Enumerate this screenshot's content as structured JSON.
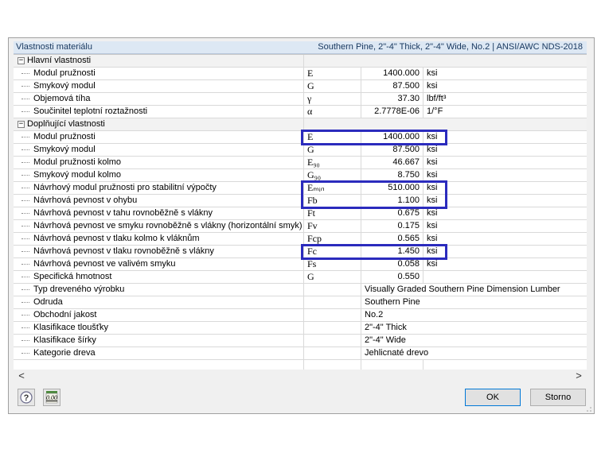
{
  "header": {
    "title": "Vlastnosti materiálu",
    "material": "Southern Pine, 2\"-4\" Thick, 2\"-4\" Wide, No.2  |  ANSI/AWC NDS-2018"
  },
  "sections": [
    {
      "label": "Hlavní vlastnosti",
      "toggle": "−",
      "rows": [
        {
          "name": "Modul pružnosti",
          "symbol": "E",
          "value": "1400.000",
          "unit": "ksi"
        },
        {
          "name": "Smykový modul",
          "symbol": "G",
          "value": "87.500",
          "unit": "ksi"
        },
        {
          "name": "Objemová tíha",
          "symbol": "γ",
          "value": "37.30",
          "unit": "lbf/ft³"
        },
        {
          "name": "Součinitel teplotní roztažnosti",
          "symbol": "α",
          "value": "2.7778E-06",
          "unit": "1/°F"
        }
      ]
    },
    {
      "label": "Doplňující vlastnosti",
      "toggle": "−",
      "rows": [
        {
          "name": "Modul pružnosti",
          "symbol": "E",
          "value": "1400.000",
          "unit": "ksi"
        },
        {
          "name": "Smykový modul",
          "symbol": "G",
          "value": "87.500",
          "unit": "ksi"
        },
        {
          "name": "Modul pružnosti kolmo",
          "symbol": "E₉₀",
          "value": "46.667",
          "unit": "ksi"
        },
        {
          "name": "Smykový modul kolmo",
          "symbol": "G₉₀",
          "value": "8.750",
          "unit": "ksi"
        },
        {
          "name": "Návrhový modul pružnosti pro stabilitní výpočty",
          "symbol": "Eₘᵢₙ",
          "value": "510.000",
          "unit": "ksi"
        },
        {
          "name": "Návrhová pevnost v ohybu",
          "symbol": "Fb",
          "value": "1.100",
          "unit": "ksi"
        },
        {
          "name": "Návrhová pevnost v tahu rovnoběžně s vlákny",
          "symbol": "Ft",
          "value": "0.675",
          "unit": "ksi"
        },
        {
          "name": "Návrhová pevnost ve smyku rovnoběžně s vlákny (horizontální smyk)",
          "symbol": "Fv",
          "value": "0.175",
          "unit": "ksi"
        },
        {
          "name": "Návrhová pevnost v tlaku kolmo k vláknům",
          "symbol": "Fcp",
          "value": "0.565",
          "unit": "ksi"
        },
        {
          "name": "Návrhová pevnost v tlaku rovnoběžně s vlákny",
          "symbol": "Fc",
          "value": "1.450",
          "unit": "ksi"
        },
        {
          "name": "Návrhová pevnost ve valivém smyku",
          "symbol": "Fs",
          "value": "0.058",
          "unit": "ksi"
        },
        {
          "name": "Specifická hmotnost",
          "symbol": "G",
          "value": "0.550",
          "unit": ""
        }
      ],
      "info_rows": [
        {
          "name": "Typ dreveného výrobku",
          "value": "Visually Graded Southern Pine Dimension Lumber"
        },
        {
          "name": "Odruda",
          "value": "Southern Pine"
        },
        {
          "name": "Obchodní jakost",
          "value": "No.2"
        },
        {
          "name": "Klasifikace tloušťky",
          "value": "2\"-4\" Thick"
        },
        {
          "name": "Klasifikace šírky",
          "value": "2\"-4\" Wide"
        },
        {
          "name": "Kategorie dreva",
          "value": "Jehlicnaté drevo"
        }
      ]
    }
  ],
  "highlighted_rows": [
    "E",
    "Eₘᵢₙ",
    "Fb",
    "Fc"
  ],
  "buttons": {
    "ok": "OK",
    "cancel": "Storno"
  },
  "scrollbar": {
    "left": "<",
    "right": ">"
  },
  "icons": {
    "help": "help-icon",
    "units": "units-icon",
    "units_text": "0.00"
  },
  "colors": {
    "highlight": "#2b2bbd",
    "header_bg": "#dde8f4",
    "header_text": "#17375e"
  }
}
